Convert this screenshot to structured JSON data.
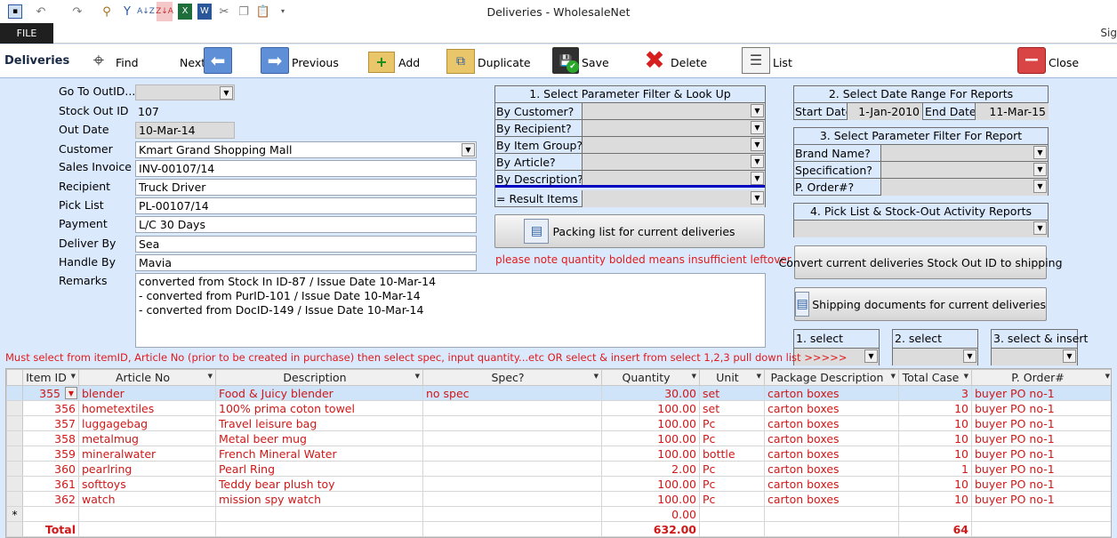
{
  "window": {
    "title": "Deliveries - WholesaleNet",
    "file_tab": "FILE",
    "signin_partial": "Sig"
  },
  "toolbar": {
    "section_label": "Deliveries",
    "find": "Find",
    "next": "Next",
    "previous": "Previous",
    "add": "Add",
    "duplicate": "Duplicate",
    "save": "Save",
    "delete": "Delete",
    "list": "List",
    "close": "Close"
  },
  "form": {
    "goto_label": "Go To OutID....",
    "goto_value": "",
    "stock_out_id_label": "Stock Out ID",
    "stock_out_id": "107",
    "out_date_label": "Out Date",
    "out_date": "10-Mar-14",
    "customer_label": "Customer",
    "customer": "Kmart Grand Shopping Mall",
    "sales_invoice_label": "Sales Invoice",
    "sales_invoice": "INV-00107/14",
    "recipient_label": "Recipient",
    "recipient": "Truck Driver",
    "pick_list_label": "Pick List",
    "pick_list": "PL-00107/14",
    "payment_label": "Payment",
    "payment": "L/C 30 Days",
    "deliver_by_label": "Deliver By",
    "deliver_by": "Sea",
    "handle_by_label": "Handle By",
    "handle_by": "Mavia",
    "remarks_label": "Remarks",
    "remarks": [
      "converted from   Stock In ID-87 / Issue Date  10-Mar-14",
      "- converted from   PurID-101 / Issue Date  10-Mar-14",
      "- converted from   DocID-149 / Issue Date  10-Mar-14"
    ]
  },
  "filter_panel": {
    "title": "1. Select Parameter Filter & Look Up",
    "rows": [
      "By Customer?",
      "By Recipient?",
      "By Item Group?",
      "By Article?",
      "By Description?"
    ],
    "result_label": "= Result Items",
    "packing_button": "Packing list for current deliveries",
    "note": "please note quantity bolded means insufficient leftover"
  },
  "date_panel": {
    "title": "2. Select Date Range For  Reports",
    "start_label": "Start Date",
    "start_date": "1-Jan-2010",
    "end_label": "End Date",
    "end_date": "11-Mar-15"
  },
  "report_panel": {
    "title": "3. Select Parameter Filter For Report",
    "rows": [
      "Brand Name?",
      "Specification?",
      "P. Order#?"
    ]
  },
  "pick_panel": {
    "title": "4. Pick List & Stock-Out Activity Reports",
    "convert_button": "Convert current deliveries Stock Out ID to shipping",
    "shipping_button": "Shipping documents for current deliveries"
  },
  "selects": {
    "select1": "1. select",
    "select2": "2. select",
    "select3": "3. select & insert"
  },
  "instruction": "Must select from itemID, Article No (prior to be created in purchase) then select spec, input quantity...etc OR select & insert from select 1,2,3 pull down list >>>>>",
  "grid": {
    "columns": [
      "Item ID",
      "Article No",
      "Description",
      "Spec?",
      "Quantity",
      "Unit",
      "Package Description",
      "Total Case",
      "P. Order#"
    ],
    "rows": [
      {
        "item_id": "355",
        "article": "blender",
        "desc": "Food & Juicy blender",
        "spec": "no spec",
        "qty": "30.00",
        "unit": "set",
        "pkg": "carton boxes",
        "cases": "3",
        "po": "buyer PO no-1"
      },
      {
        "item_id": "356",
        "article": "hometextiles",
        "desc": "100% prima coton towel",
        "spec": "",
        "qty": "100.00",
        "unit": "set",
        "pkg": "carton boxes",
        "cases": "10",
        "po": "buyer PO no-1"
      },
      {
        "item_id": "357",
        "article": "luggagebag",
        "desc": "Travel leisure bag",
        "spec": "",
        "qty": "100.00",
        "unit": "Pc",
        "pkg": "carton boxes",
        "cases": "10",
        "po": "buyer PO no-1"
      },
      {
        "item_id": "358",
        "article": "metalmug",
        "desc": "Metal beer mug",
        "spec": "",
        "qty": "100.00",
        "unit": "Pc",
        "pkg": "carton boxes",
        "cases": "10",
        "po": "buyer PO no-1"
      },
      {
        "item_id": "359",
        "article": "mineralwater",
        "desc": "French Mineral Water",
        "spec": "",
        "qty": "100.00",
        "unit": "bottle",
        "pkg": "carton boxes",
        "cases": "10",
        "po": "buyer PO no-1"
      },
      {
        "item_id": "360",
        "article": "pearlring",
        "desc": "Pearl Ring",
        "spec": "",
        "qty": "2.00",
        "unit": "Pc",
        "pkg": "carton boxes",
        "cases": "1",
        "po": "buyer PO no-1"
      },
      {
        "item_id": "361",
        "article": "softtoys",
        "desc": "Teddy bear plush toy",
        "spec": "",
        "qty": "100.00",
        "unit": "Pc",
        "pkg": "carton boxes",
        "cases": "10",
        "po": "buyer PO no-1"
      },
      {
        "item_id": "362",
        "article": "watch",
        "desc": "mission spy watch",
        "spec": "",
        "qty": "100.00",
        "unit": "Pc",
        "pkg": "carton boxes",
        "cases": "10",
        "po": "buyer PO no-1"
      }
    ],
    "new_row_marker": "*",
    "new_row_qty": "0.00",
    "total_label": "Total",
    "total_qty": "632.00",
    "total_cases": "64"
  },
  "colors": {
    "background": "#dbe9fd",
    "grid_text": "#d01818",
    "selected_row": "#cfe3f9",
    "accent_blue": "#0000c0"
  },
  "icons": [
    "save-file-icon",
    "undo-icon",
    "redo-icon",
    "binoculars-icon",
    "arrow-left-icon",
    "arrow-right-icon",
    "folder-add-icon",
    "duplicate-icon",
    "floppy-save-icon",
    "delete-x-icon",
    "list-icon",
    "close-minus-icon"
  ]
}
